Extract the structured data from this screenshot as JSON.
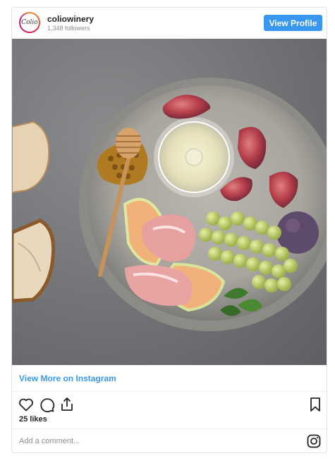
{
  "header": {
    "avatar_text": "Colio",
    "username": "coliowinery",
    "followers": "1,348 followers",
    "view_profile_label": "View Profile"
  },
  "post": {
    "image_alt": "",
    "view_more_label": "View More on Instagram",
    "likes": "25 likes"
  },
  "actions": {
    "like_icon": "heart-icon",
    "comment_icon": "comment-icon",
    "share_icon": "share-icon",
    "save_icon": "bookmark-icon"
  },
  "comment": {
    "placeholder": "Add a comment...",
    "instagram_icon": "instagram-icon"
  },
  "colors": {
    "accent": "#3897f0",
    "text": "#262626",
    "muted": "#8e8e8e",
    "border": "#e2e2e2"
  }
}
